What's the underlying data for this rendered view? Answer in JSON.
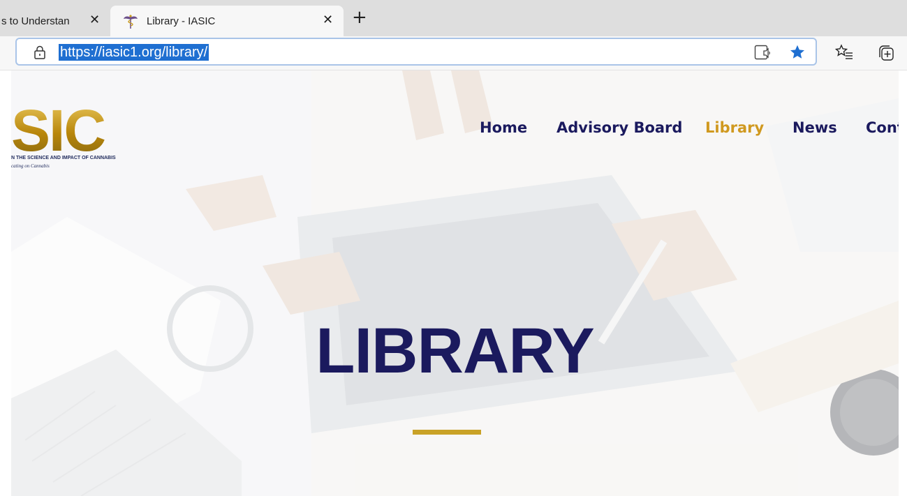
{
  "browser": {
    "tabs": [
      {
        "title": "s to Understan",
        "active": false
      },
      {
        "title": "Library - IASIC",
        "active": true
      }
    ],
    "close_glyph": "✕",
    "new_tab_glyph": "+",
    "url": "https://iasic1.org/library/",
    "icons": {
      "lock": "lock-icon",
      "reader": "immersive-reader-icon",
      "favorite": "star-filled-icon",
      "favorites": "favorites-list-icon",
      "collections": "collections-icon"
    },
    "accent": "#1f6fd1"
  },
  "site": {
    "logo": {
      "letters": "SIC",
      "subtitle": "N THE SCIENCE AND IMPACT OF CANNABIS",
      "tagline": "cating on Cannabis"
    },
    "nav": [
      {
        "label": "Home",
        "active": false
      },
      {
        "label": "Advisory Board",
        "active": false
      },
      {
        "label": "Library",
        "active": true
      },
      {
        "label": "News",
        "active": false
      },
      {
        "label": "Cont",
        "active": false
      }
    ],
    "heading": "LIBRARY",
    "colors": {
      "navy": "#1b1a5e",
      "gold": "#d0991f",
      "rule": "#c9a227"
    }
  }
}
